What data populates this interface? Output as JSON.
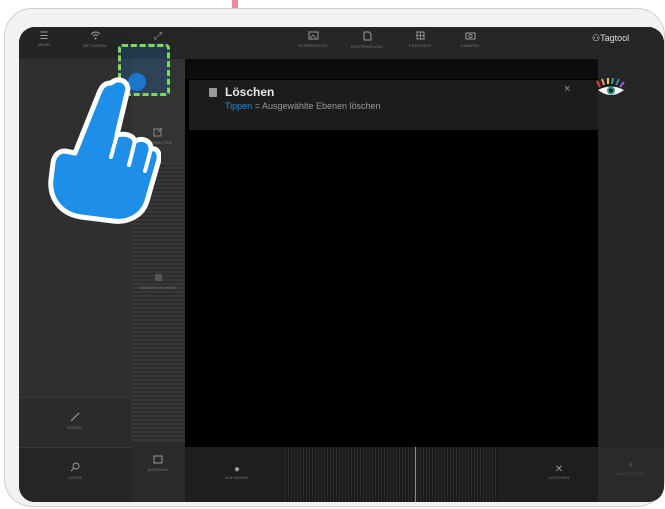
{
  "toolbar_left": {
    "menu": "MENÜ",
    "network": "NETZWERK",
    "fullscreen": "VOLLBILD"
  },
  "toolbar_center": {
    "screenshot": "SCREENSHOT",
    "background": "HINTERGRUND",
    "insert": "EINFÜGEN",
    "camera": "KAMERA"
  },
  "brand": "Tagtool",
  "notification": {
    "title": "Löschen",
    "tap_word": "Tippen",
    "body": " = Ausgewählte Ebenen löschen",
    "close": "×"
  },
  "middle_panel": {
    "edit_label": "BEARBEITEN",
    "layers_label": "EBENEN WÄHLEN",
    "select_label": "AUSWAHL"
  },
  "left_panel": {
    "brush_label": "PINSEL",
    "zoom_label": "ZOOM"
  },
  "bottom_bar": {
    "record_label": "AUFNAHME",
    "delete_label": "LÖSCHEN"
  },
  "right_panel": {
    "new_label": "HINZUFÜGEN"
  },
  "colors": {
    "accent_blue": "#1e8fe0",
    "highlight_green": "#7ed957",
    "hand_blue": "#1e90ff"
  },
  "icons": [
    "menu-icon",
    "wifi-icon",
    "fullscreen-icon",
    "screenshot-icon",
    "document-icon",
    "grid-icon",
    "camera-icon",
    "close-icon",
    "brush-icon",
    "search-icon",
    "square-icon",
    "record-icon",
    "add-icon",
    "eye-logo-icon",
    "hand-pointer-icon"
  ]
}
